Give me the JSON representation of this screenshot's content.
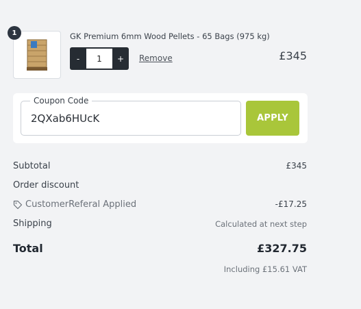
{
  "line_item": {
    "badge_count": "1",
    "title": "GK Premium 6mm Wood Pellets - 65 Bags (975 kg)",
    "minus_label": "-",
    "plus_label": "+",
    "quantity": "1",
    "remove_label": "Remove",
    "price": "£345",
    "thumbnail_icon": "pellet-pallet-icon"
  },
  "coupon": {
    "label": "Coupon Code",
    "value": "2QXab6HUcK",
    "apply_label": "APPLY"
  },
  "summary": {
    "subtotal_label": "Subtotal",
    "subtotal_value": "£345",
    "order_discount_label": "Order discount",
    "discount_name": "CustomerReferal Applied",
    "discount_value": "-£17.25",
    "discount_icon": "tag-icon",
    "shipping_label": "Shipping",
    "shipping_value": "Calculated at next step",
    "total_label": "Total",
    "total_value": "£327.75",
    "vat_note": "Including £15.61 VAT"
  },
  "colors": {
    "background": "#f2f3f5",
    "apply_button": "#a9c63a",
    "stepper": "#262c33",
    "badge": "#2d3540"
  }
}
